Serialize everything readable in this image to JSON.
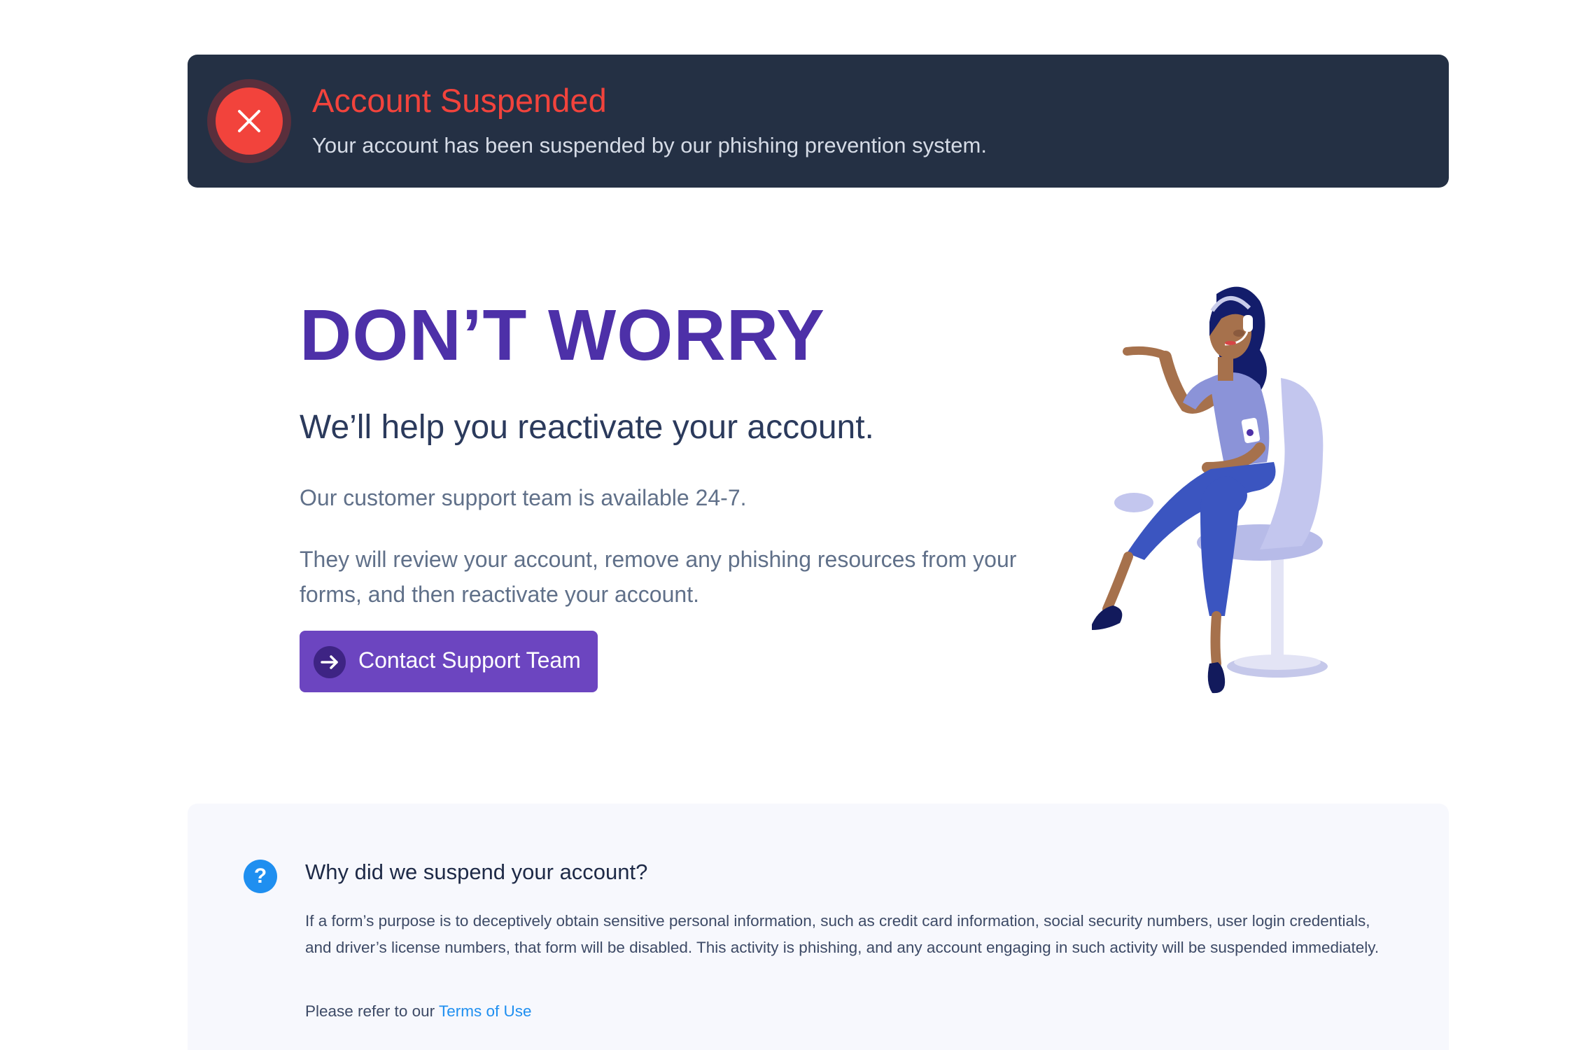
{
  "alert": {
    "icon": "close-icon",
    "title": "Account Suspended",
    "message": "Your account has been suspended by our phishing prevention system.",
    "colors": {
      "background": "#243044",
      "accent": "#f2433c"
    }
  },
  "hero": {
    "title": "DON’T WORRY",
    "subtitle": "We’ll help you reactivate your account.",
    "paragraph1": "Our customer support team is available 24-7.",
    "paragraph2": "They will review your account, remove any phishing resources from your forms, and then reactivate your account.",
    "cta": {
      "label": "Contact Support Team",
      "icon": "arrow-right-icon"
    },
    "illustration": "support-agent-illustration",
    "colors": {
      "title": "#4d30a8",
      "button": "#6c45c0"
    }
  },
  "faq": {
    "icon": "question-mark-icon",
    "icon_glyph": "?",
    "title": "Why did we suspend your account?",
    "body": "If a form’s purpose is to deceptively obtain sensitive personal information, such as credit card information, social security numbers, user login credentials, and driver’s license numbers, that form will be disabled. This activity is phishing, and any account engaging in such activity will be suspended immediately.",
    "footer_prefix": "Please refer to our ",
    "link_label": "Terms of Use",
    "colors": {
      "link": "#1f8ff0"
    }
  }
}
